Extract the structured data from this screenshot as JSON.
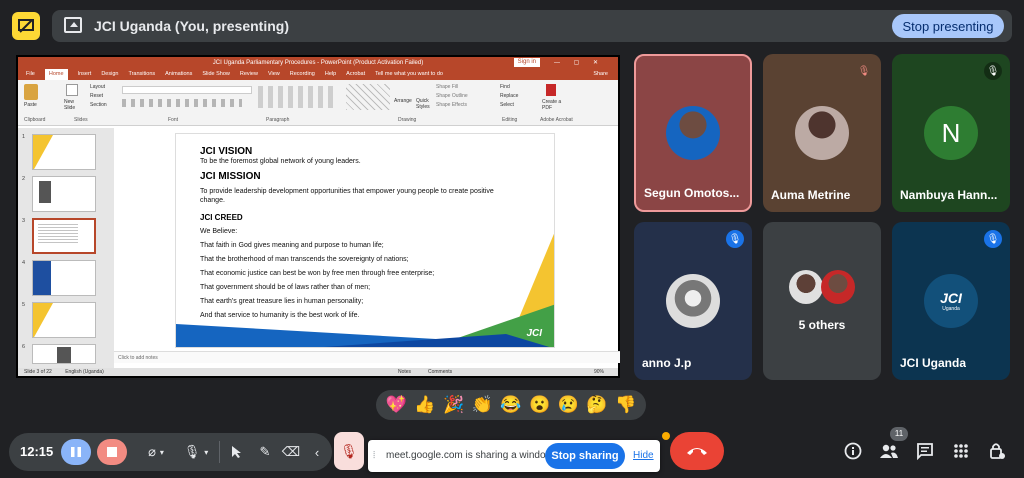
{
  "presentation_bar": {
    "title": "JCI Uganda (You, presenting)",
    "stop_label": "Stop presenting"
  },
  "ppt": {
    "window_title": "JCI Uganda Parliamentary Procedures - PowerPoint (Product Activation Failed)",
    "signin": "Sign in",
    "share": "Share",
    "menus": [
      "File",
      "Home",
      "Insert",
      "Design",
      "Transitions",
      "Animations",
      "Slide Show",
      "Review",
      "View",
      "Recording",
      "Help",
      "Acrobat",
      "Tell me what you want to do"
    ],
    "ribbon": {
      "clipboard": "Clipboard",
      "slides": "Slides",
      "font": "Font",
      "paragraph": "Paragraph",
      "drawing": "Drawing",
      "editing": "Editing",
      "acrobat": "Adobe Acrobat",
      "paste": "Paste",
      "new_slide": "New Slide",
      "layout": "Layout",
      "reset": "Reset",
      "section": "Section",
      "arrange": "Arrange",
      "quick_styles": "Quick Styles",
      "shape_fill": "Shape Fill",
      "shape_outline": "Shape Outline",
      "shape_effects": "Shape Effects",
      "find": "Find",
      "replace": "Replace",
      "select": "Select",
      "create_pdf": "Create a PDF"
    },
    "thumb_numbers": [
      "1",
      "2",
      "3",
      "4",
      "5",
      "6"
    ],
    "notes_placeholder": "Click to add notes",
    "status_left": "Slide 3 of 22",
    "status_lang": "English (Uganda)",
    "status_notes": "Notes",
    "status_comments": "Comments",
    "zoom": "90%"
  },
  "slide": {
    "vision_title": "JCI VISION",
    "vision_text": "To be the foremost global network of young leaders.",
    "mission_title": "JCI MISSION",
    "mission_text": "To provide leadership development opportunities that empower young people to create positive change.",
    "creed_title": "JCI CREED",
    "creed_lines": [
      "We Believe:",
      "That faith in God gives meaning and purpose to human life;",
      "That the brotherhood of man transcends the sovereignty of nations;",
      "That economic justice can best be won by free men through free enterprise;",
      "That government should be of laws rather than of men;",
      "That earth's great treasure lies in human personality;",
      "And that service to humanity is the best work of life."
    ],
    "logo": "JCI"
  },
  "tiles": [
    {
      "name": "Segun Omotos...",
      "color": "#8b4545"
    },
    {
      "name": "Auma Metrine",
      "color": "#5a4232"
    },
    {
      "name": "Nambuya Hann...",
      "initial": "N",
      "color": "#1e4620"
    },
    {
      "name": "anno J.p",
      "color": "#24304a"
    },
    {
      "name": "5 others",
      "color": "#3c4043"
    },
    {
      "name": "JCI Uganda",
      "logo": "JCI",
      "sublogo": "Uganda",
      "color": "#0c3450"
    }
  ],
  "reactions": [
    "💖",
    "👍",
    "🎉",
    "👏",
    "😂",
    "😮",
    "😢",
    "🤔",
    "👎"
  ],
  "controls": {
    "time": "12:15"
  },
  "sharebar": {
    "message": "meet.google.com is sharing a window.",
    "stop_label": "Stop sharing",
    "hide_label": "Hide"
  },
  "participants_count": "11",
  "colors": {
    "accent": "#a8c7fa",
    "endcall": "#ea4335",
    "ppt_brand": "#b7472a",
    "jci_blue": "#1e88e5"
  }
}
